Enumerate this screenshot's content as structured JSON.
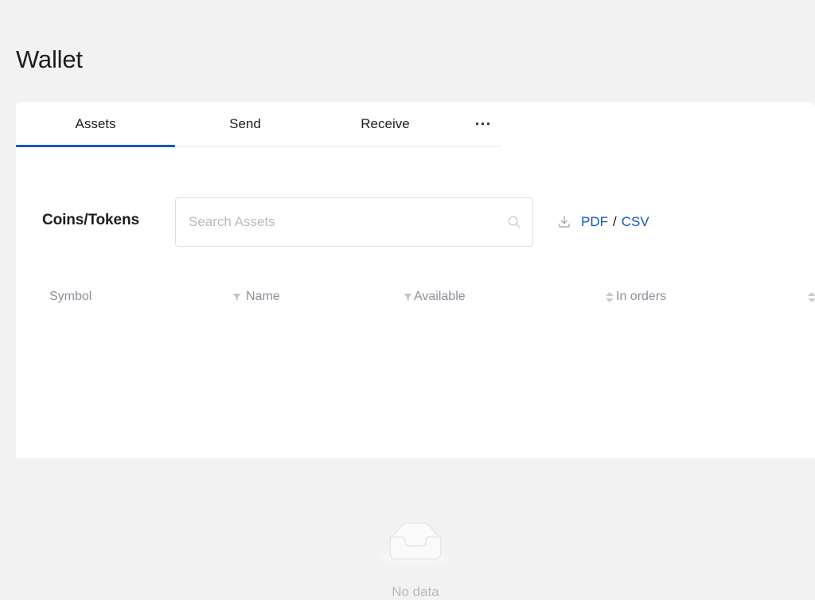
{
  "page": {
    "title": "Wallet",
    "background_color": "#f2f2f2",
    "card_background": "#ffffff",
    "accent_color": "#1557c0"
  },
  "tabs": {
    "items": [
      {
        "label": "Assets",
        "active": true
      },
      {
        "label": "Send",
        "active": false
      },
      {
        "label": "Receive",
        "active": false
      }
    ],
    "more_icon": "ellipsis-icon"
  },
  "filter_bar": {
    "section_label": "Coins/Tokens",
    "search": {
      "placeholder": "Search Assets",
      "value": "",
      "icon": "search-icon"
    },
    "export": {
      "download_icon": "download-icon",
      "pdf_label": "PDF",
      "separator": "/",
      "csv_label": "CSV",
      "link_color": "#1557c0"
    }
  },
  "table": {
    "columns": [
      {
        "key": "symbol",
        "label": "Symbol",
        "tool": "none"
      },
      {
        "key": "name",
        "label": "Name",
        "tool": "filter-icon"
      },
      {
        "key": "available",
        "label": "Available",
        "tool": "filter-icon"
      },
      {
        "key": "in_orders",
        "label": "In orders",
        "tool": "sort-icon"
      }
    ],
    "tools": {
      "name_filter": "filter-icon",
      "available_filter": "filter-icon",
      "available_sort": "sort-icon",
      "in_orders_sort": "sort-icon"
    },
    "rows": [],
    "empty": {
      "icon": "empty-inbox-icon",
      "text": "No data"
    }
  }
}
